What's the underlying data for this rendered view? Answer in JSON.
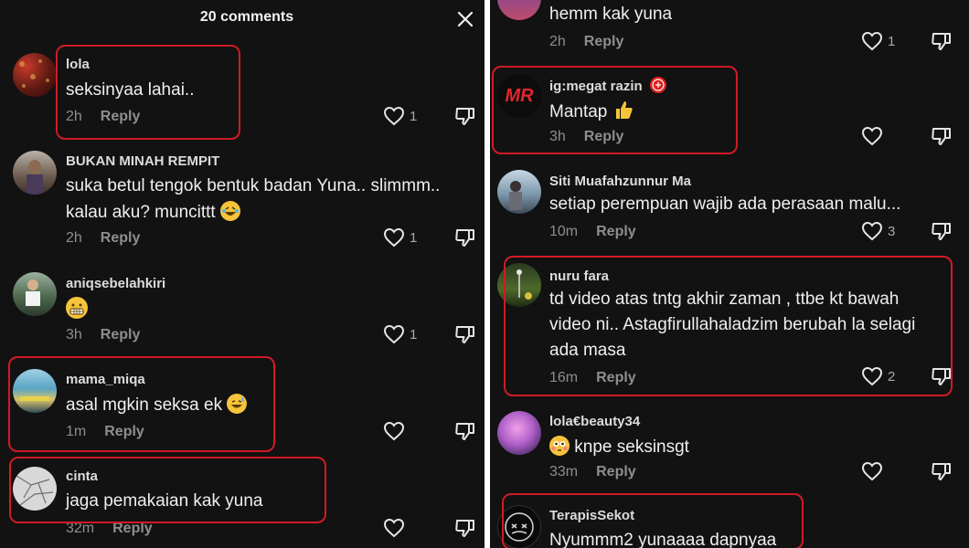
{
  "header": {
    "title": "20 comments"
  },
  "left_comments": [
    {
      "username": "lola",
      "lines": [
        "seksinyaa lahai.."
      ],
      "time": "2h",
      "reply": "Reply",
      "likes": "1"
    },
    {
      "username": "BUKAN MINAH REMPIT",
      "lines": [
        "suka betul tengok bentuk badan Yuna.. slimmm..",
        "kalau aku? muncittt"
      ],
      "time": "2h",
      "reply": "Reply",
      "likes": "1"
    },
    {
      "username": "aniqsebelahkiri",
      "lines": [
        ""
      ],
      "time": "3h",
      "reply": "Reply",
      "likes": "1"
    },
    {
      "username": "mama_miqa",
      "lines": [
        "asal mgkin seksa ek"
      ],
      "time": "1m",
      "reply": "Reply",
      "likes": ""
    },
    {
      "username": "cinta",
      "lines": [
        "jaga pemakaian kak yuna"
      ],
      "time": "32m",
      "reply": "Reply",
      "likes": ""
    }
  ],
  "right_comments": [
    {
      "username": "",
      "lines": [
        "hemm kak yuna"
      ],
      "time": "2h",
      "reply": "Reply",
      "likes": "1"
    },
    {
      "username": "ig:megat razin",
      "lines": [
        "Mantap"
      ],
      "time": "3h",
      "reply": "Reply",
      "likes": ""
    },
    {
      "username": "Siti Muafahzunnur Ma",
      "lines": [
        "setiap perempuan wajib ada perasaan malu..."
      ],
      "time": "10m",
      "reply": "Reply",
      "likes": "3"
    },
    {
      "username": "nuru fara",
      "lines": [
        "td video atas tntg akhir zaman , ttbe kt bawah",
        "video ni.. Astagfirullahaladzim berubah la selagi",
        "ada masa"
      ],
      "time": "16m",
      "reply": "Reply",
      "likes": "2"
    },
    {
      "username": "lola€beauty34",
      "lines": [
        "knpe seksinsgt"
      ],
      "time": "33m",
      "reply": "Reply",
      "likes": ""
    },
    {
      "username": "TerapisSekot",
      "lines": [
        "Nyummm2 yunaaaa dapnyaa"
      ],
      "time": "",
      "reply": "",
      "likes": ""
    }
  ],
  "avatars": {
    "mr_text": "MR"
  },
  "colors": {
    "highlight": "#d11a24",
    "background": "#121212",
    "muted": "#8e8e8e"
  },
  "icons": [
    "close-icon",
    "heart-icon",
    "dislike-icon"
  ]
}
